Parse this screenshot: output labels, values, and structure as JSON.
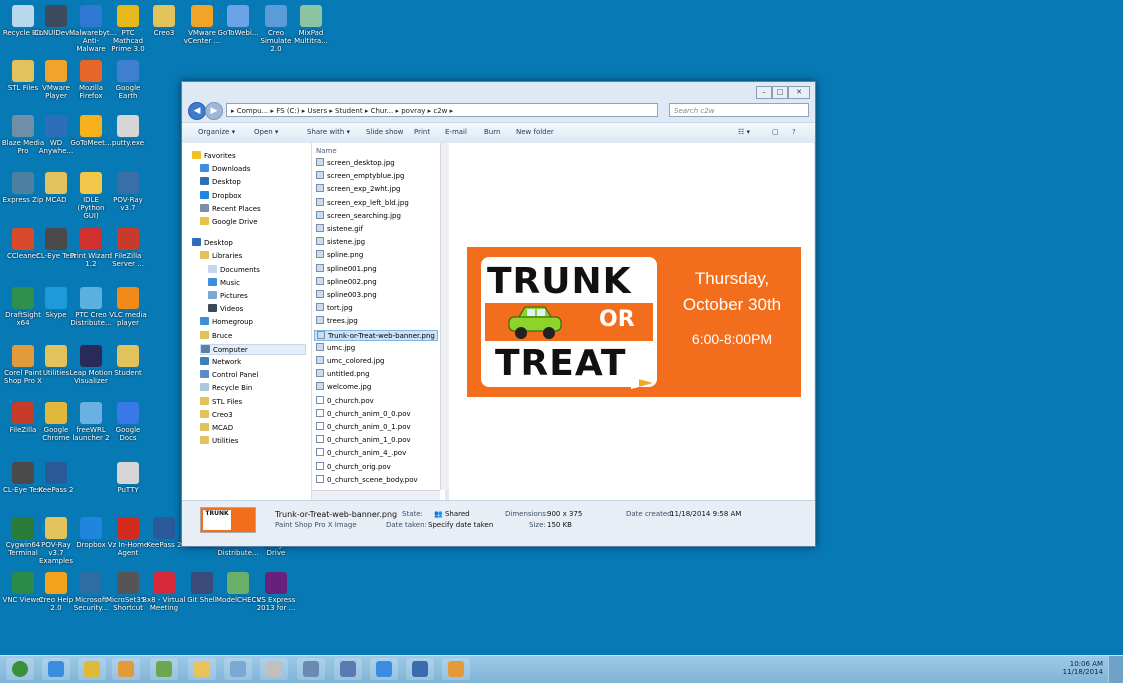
{
  "desktop": {
    "icons": [
      {
        "label": "Recycle Bin",
        "icon": "recycle-bin-icon",
        "color": "#b8d8ee"
      },
      {
        "label": "CLNUIDevi...",
        "icon": "folder-icon",
        "color": "#3b4a5c"
      },
      {
        "label": "Malwarebyt... Anti-Malware",
        "icon": "malwarebytes-icon",
        "color": "#2f78d1"
      },
      {
        "label": "PTC Mathcad Prime 3.0",
        "icon": "mathcad-icon",
        "color": "#e6b91a"
      },
      {
        "label": "Creo3",
        "icon": "folder-icon",
        "color": "#e2c25a"
      },
      {
        "label": "VMware vCenter ...",
        "icon": "vmware-icon",
        "color": "#f2a42a"
      },
      {
        "label": "GoToWebi...",
        "icon": "gotowebinar-icon",
        "color": "#6aa3e8"
      },
      {
        "label": "Creo Simulate 2.0",
        "icon": "creo-icon",
        "color": "#5b9bd8"
      },
      {
        "label": "MixPad Multitra...",
        "icon": "mixpad-icon",
        "color": "#8cc3a2"
      },
      {
        "label": "STL Files",
        "icon": "folder-icon",
        "color": "#e2c25a"
      },
      {
        "label": "VMware Player",
        "icon": "vmware-icon",
        "color": "#f2a42a"
      },
      {
        "label": "Mozilla Firefox",
        "icon": "firefox-icon",
        "color": "#e8662a"
      },
      {
        "label": "Google Earth",
        "icon": "google-earth-icon",
        "color": "#3e7fd0"
      },
      {
        "label": "Blaze Media Pro",
        "icon": "blaze-media-icon",
        "color": "#6f8fa8"
      },
      {
        "label": "WD Anywhe...",
        "icon": "wd-icon",
        "color": "#2a6fb8"
      },
      {
        "label": "GoToMeet...",
        "icon": "gotomeeting-icon",
        "color": "#f5b21c"
      },
      {
        "label": "putty.exe",
        "icon": "putty-icon",
        "color": "#d6d6d6"
      },
      {
        "label": "Express Zip",
        "icon": "express-zip-icon",
        "color": "#4d7fa3"
      },
      {
        "label": "MCAD",
        "icon": "folder-icon",
        "color": "#e2c25a"
      },
      {
        "label": "IDLE (Python GUI)",
        "icon": "python-icon",
        "color": "#f2c84a"
      },
      {
        "label": "POV-Ray v3.7",
        "icon": "povray-icon",
        "color": "#3a6ea8"
      },
      {
        "label": "CCleaner",
        "icon": "ccleaner-icon",
        "color": "#d94a2a"
      },
      {
        "label": "CL-Eye Test",
        "icon": "camera-icon",
        "color": "#4a4a4a"
      },
      {
        "label": "Print Wizard 1.2",
        "icon": "print-wizard-icon",
        "color": "#d13030"
      },
      {
        "label": "FileZilla Server ...",
        "icon": "filezilla-icon",
        "color": "#c83a2a"
      },
      {
        "label": "DraftSight x64",
        "icon": "draftsight-icon",
        "color": "#2f8f4f"
      },
      {
        "label": "Skype",
        "icon": "skype-icon",
        "color": "#1e9ad8"
      },
      {
        "label": "PTC Creo Distribute...",
        "icon": "creo-icon",
        "color": "#5bb0e0"
      },
      {
        "label": "VLC media player",
        "icon": "vlc-icon",
        "color": "#f08a1a"
      },
      {
        "label": "Corel Paint Shop Pro X",
        "icon": "paintshop-icon",
        "color": "#e39a3a"
      },
      {
        "label": "Utilities",
        "icon": "folder-icon",
        "color": "#e2c25a"
      },
      {
        "label": "Leap Motion Visualizer",
        "icon": "leap-motion-icon",
        "color": "#2a2a5a"
      },
      {
        "label": "Student",
        "icon": "folder-icon",
        "color": "#e2c25a"
      },
      {
        "label": "FileZilla",
        "icon": "filezilla-icon",
        "color": "#c83a2a"
      },
      {
        "label": "Google Chrome",
        "icon": "chrome-icon",
        "color": "#e0b83a"
      },
      {
        "label": "freeWRL launcher 2",
        "icon": "freewrl-icon",
        "color": "#6ab0e0"
      },
      {
        "label": "Google Docs",
        "icon": "google-docs-icon",
        "color": "#3b78e7"
      },
      {
        "label": "CL-Eye Test",
        "icon": "camera-icon",
        "color": "#4a4a4a"
      },
      {
        "label": "KeePass 2",
        "icon": "keepass-icon",
        "color": "#2a5a9a"
      },
      {
        "label": "PuTTY",
        "icon": "putty-icon",
        "color": "#d6d6d6"
      },
      {
        "label": "Cygwin64 Terminal",
        "icon": "cygwin-icon",
        "color": "#2a7a3a"
      },
      {
        "label": "POV-Ray v3.7 Examples",
        "icon": "folder-icon",
        "color": "#e2c25a"
      },
      {
        "label": "Dropbox",
        "icon": "dropbox-icon",
        "color": "#1f85de"
      },
      {
        "label": "Vz In-Home Agent",
        "icon": "verizon-icon",
        "color": "#d52b1e"
      },
      {
        "label": "KeePass 2",
        "icon": "keepass-icon",
        "color": "#2a5a9a"
      },
      {
        "label": "GitHub",
        "icon": "github-icon",
        "color": "#333333"
      },
      {
        "label": "Creo Distribute...",
        "icon": "creo-icon",
        "color": "#5bb0e0"
      },
      {
        "label": "Google Drive",
        "icon": "google-drive-icon",
        "color": "#3fa34d"
      },
      {
        "label": "VNC Viewer",
        "icon": "vnc-icon",
        "color": "#2a8a4a"
      },
      {
        "label": "Creo Help 2.0",
        "icon": "creo-help-icon",
        "color": "#f2a21c"
      },
      {
        "label": "Microsoft Security...",
        "icon": "security-icon",
        "color": "#2e6da4"
      },
      {
        "label": "MicroSet35 - Shortcut",
        "icon": "calculator-icon",
        "color": "#555555"
      },
      {
        "label": "8x8 - Virtual Meeting",
        "icon": "meeting-icon",
        "color": "#d8283a"
      },
      {
        "label": "Git Shell",
        "icon": "git-shell-icon",
        "color": "#3a4a7a"
      },
      {
        "label": "ModelCHECK",
        "icon": "modelcheck-icon",
        "color": "#6ab06a"
      },
      {
        "label": "VS Express 2013 for ...",
        "icon": "visual-studio-icon",
        "color": "#68217a"
      }
    ]
  },
  "window": {
    "controls": {
      "minimize": "–",
      "maximize": "□",
      "close": "✕"
    },
    "back_glyph": "◀",
    "forward_glyph": "▶",
    "address_crumbs": "▸ Compu... ▸ FS (C:) ▸ Users ▸ Student ▸ Chur... ▸ povray ▸ c2w ▸",
    "refresh_glyph": "⟳",
    "search_placeholder": "Search c2w",
    "toolbar": {
      "organize": "Organize ▾",
      "open": "Open ▾",
      "share_with": "Share with ▾",
      "slide_show": "Slide show",
      "print": "Print",
      "email": "E-mail",
      "burn": "Burn",
      "new_folder": "New folder"
    },
    "nav": [
      {
        "label": "Favorites",
        "icon": "star-icon",
        "color": "#f2c023",
        "indent": 0
      },
      {
        "label": "Downloads",
        "icon": "downloads-icon",
        "color": "#3e8edc",
        "indent": 1
      },
      {
        "label": "Desktop",
        "icon": "desktop-icon",
        "color": "#2f6fb8",
        "indent": 1
      },
      {
        "label": "Dropbox",
        "icon": "dropbox-icon",
        "color": "#1f85de",
        "indent": 1
      },
      {
        "label": "Recent Places",
        "icon": "recent-places-icon",
        "color": "#7a8ea8",
        "indent": 1
      },
      {
        "label": "Google Drive",
        "icon": "google-drive-icon",
        "color": "#e8c34a",
        "indent": 1
      },
      {
        "label": "Desktop",
        "icon": "desktop-icon",
        "color": "#2f6fb8",
        "indent": 0
      },
      {
        "label": "Libraries",
        "icon": "libraries-icon",
        "color": "#e2c25a",
        "indent": 1
      },
      {
        "label": "Documents",
        "icon": "documents-icon",
        "color": "#c7d6e8",
        "indent": 2
      },
      {
        "label": "Music",
        "icon": "music-icon",
        "color": "#3e8edc",
        "indent": 2
      },
      {
        "label": "Pictures",
        "icon": "pictures-icon",
        "color": "#7aa8d0",
        "indent": 2
      },
      {
        "label": "Videos",
        "icon": "videos-icon",
        "color": "#3a4a5a",
        "indent": 2
      },
      {
        "label": "Homegroup",
        "icon": "homegroup-icon",
        "color": "#3e8edc",
        "indent": 1
      },
      {
        "label": "Bruce",
        "icon": "user-folder-icon",
        "color": "#e2c25a",
        "indent": 1
      },
      {
        "label": "Computer",
        "icon": "computer-icon",
        "color": "#5c7fa8",
        "indent": 1
      },
      {
        "label": "Network",
        "icon": "network-icon",
        "color": "#3e7fb8",
        "indent": 1
      },
      {
        "label": "Control Panel",
        "icon": "control-panel-icon",
        "color": "#5a8ac8",
        "indent": 1
      },
      {
        "label": "Recycle Bin",
        "icon": "recycle-bin-icon",
        "color": "#a8c8e0",
        "indent": 1
      },
      {
        "label": "STL Files",
        "icon": "folder-icon",
        "color": "#e2c25a",
        "indent": 1
      },
      {
        "label": "Creo3",
        "icon": "folder-icon",
        "color": "#e2c25a",
        "indent": 1
      },
      {
        "label": "MCAD",
        "icon": "folder-icon",
        "color": "#e2c25a",
        "indent": 1
      },
      {
        "label": "Utilities",
        "icon": "folder-icon",
        "color": "#e2c25a",
        "indent": 1
      }
    ],
    "selected_nav": "Computer",
    "column_header": "Name",
    "files": [
      {
        "name": "screen_desktop.jpg",
        "type": "image"
      },
      {
        "name": "screen_emptyblue.jpg",
        "type": "image"
      },
      {
        "name": "screen_exp_2wht.jpg",
        "type": "image"
      },
      {
        "name": "screen_exp_left_bld.jpg",
        "type": "image"
      },
      {
        "name": "screen_searching.jpg",
        "type": "image"
      },
      {
        "name": "sistene.gif",
        "type": "image"
      },
      {
        "name": "sistene.jpg",
        "type": "image"
      },
      {
        "name": "spline.png",
        "type": "image"
      },
      {
        "name": "spline001.png",
        "type": "image"
      },
      {
        "name": "spline002.png",
        "type": "image"
      },
      {
        "name": "spline003.png",
        "type": "image"
      },
      {
        "name": "tort.jpg",
        "type": "image"
      },
      {
        "name": "trees.jpg",
        "type": "image"
      },
      {
        "name": "Trunk-or-Treat-web-banner.png",
        "type": "image"
      },
      {
        "name": "umc.jpg",
        "type": "image"
      },
      {
        "name": "umc_colored.jpg",
        "type": "image"
      },
      {
        "name": "untitled.png",
        "type": "image"
      },
      {
        "name": "welcome.jpg",
        "type": "image"
      },
      {
        "name": "0_church.pov",
        "type": "pov"
      },
      {
        "name": "0_church_anim_0_0.pov",
        "type": "pov"
      },
      {
        "name": "0_church_anim_0_1.pov",
        "type": "pov"
      },
      {
        "name": "0_church_anim_1_0.pov",
        "type": "pov"
      },
      {
        "name": "0_church_anim_4_.pov",
        "type": "pov"
      },
      {
        "name": "0_church_orig.pov",
        "type": "pov"
      },
      {
        "name": "0_church_scene_body.pov",
        "type": "pov"
      }
    ],
    "selected_file": "Trunk-or-Treat-web-banner.png",
    "preview": {
      "logo_top": "TRUNK",
      "logo_middle": "OR",
      "logo_bottom": "TREAT",
      "line1": "Thursday,",
      "line2": "October 30th",
      "line3": "6:00-8:00PM",
      "banner_color": "#f26d1c"
    },
    "details": {
      "file_name": "Trunk-or-Treat-web-banner.png",
      "file_type": "Paint Shop Pro X Image",
      "state_label": "State:",
      "state_value": "Shared",
      "date_taken_label": "Date taken:",
      "date_taken_value": "Specify date taken",
      "dimensions_label": "Dimensions:",
      "dimensions_value": "900 x 375",
      "size_label": "Size:",
      "size_value": "150 KB",
      "date_created_label": "Date created:",
      "date_created_value": "11/18/2014 9:58 AM"
    }
  },
  "taskbar": {
    "items": [
      {
        "icon": "start-orb-icon",
        "color": "#3a8f3a"
      },
      {
        "icon": "internet-explorer-icon",
        "color": "#3b8de0"
      },
      {
        "icon": "chrome-icon",
        "color": "#e0b83a"
      },
      {
        "icon": "paintshop-icon",
        "color": "#e39a3a"
      },
      {
        "icon": "notepad-icon",
        "color": "#6aa84f"
      },
      {
        "icon": "file-explorer-icon",
        "color": "#e8c35a"
      },
      {
        "icon": "window-icon",
        "color": "#7aa8d0"
      },
      {
        "icon": "povray-icon",
        "color": "#c0c0c0"
      },
      {
        "icon": "network-icon",
        "color": "#6a8ab0"
      },
      {
        "icon": "gear-app-icon",
        "color": "#5a7ab0"
      },
      {
        "icon": "internet-explorer-icon",
        "color": "#3b8de0"
      },
      {
        "icon": "photo-viewer-icon",
        "color": "#3a6ab0"
      },
      {
        "icon": "explorer-active-icon",
        "color": "#e39a3a"
      }
    ],
    "time": "10:06 AM",
    "date": "11/18/2014"
  }
}
